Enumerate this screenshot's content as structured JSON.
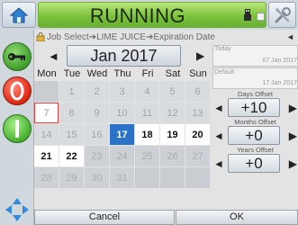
{
  "status": {
    "text": "RUNNING"
  },
  "icons": {
    "home": "home-icon",
    "tools": "tools-icon",
    "usb": "usb-icon",
    "key": "key-icon",
    "stop": "stop-icon",
    "start": "start-icon",
    "nav": "navigation-arrows-icon"
  },
  "breadcrumb": {
    "text": "Job Select➔LIME JUICE➔Expiration Date",
    "back_arrow": "◄"
  },
  "calendar": {
    "month_label": "Jan 2017",
    "prev_arrow": "◄",
    "next_arrow": "▶",
    "days_of_week": [
      "Mon",
      "Tue",
      "Wed",
      "Thu",
      "Fri",
      "Sat",
      "Sun"
    ],
    "weeks": [
      [
        "",
        "1",
        "2",
        "3",
        "4",
        "5",
        "6"
      ],
      [
        "7",
        "8",
        "9",
        "10",
        "11",
        "12",
        "13"
      ],
      [
        "14",
        "15",
        "16",
        "17",
        "18",
        "19",
        "20"
      ],
      [
        "21",
        "22",
        "23",
        "24",
        "25",
        "26",
        "27"
      ],
      [
        "28",
        "29",
        "30",
        "31",
        "",
        "",
        ""
      ]
    ],
    "selected_day": "17",
    "today_day": "7"
  },
  "right_panel": {
    "today_label": "Today",
    "today_value": "07 Jan 2017",
    "default_label": "Default",
    "default_value": "17 Jan 2017",
    "days_offset_label": "Days Offset",
    "days_offset_value": "+10",
    "months_offset_label": "Months Offset",
    "months_offset_value": "+0",
    "years_offset_label": "Years Offset",
    "years_offset_value": "+0",
    "dec_arrow": "◄",
    "inc_arrow": "▶"
  },
  "buttons": {
    "cancel": "Cancel",
    "ok": "OK"
  },
  "colors": {
    "running_green": "#7cc23e",
    "selected_blue": "#2b72c9",
    "stop_red": "#e12a14",
    "today_outline": "#e04040"
  }
}
